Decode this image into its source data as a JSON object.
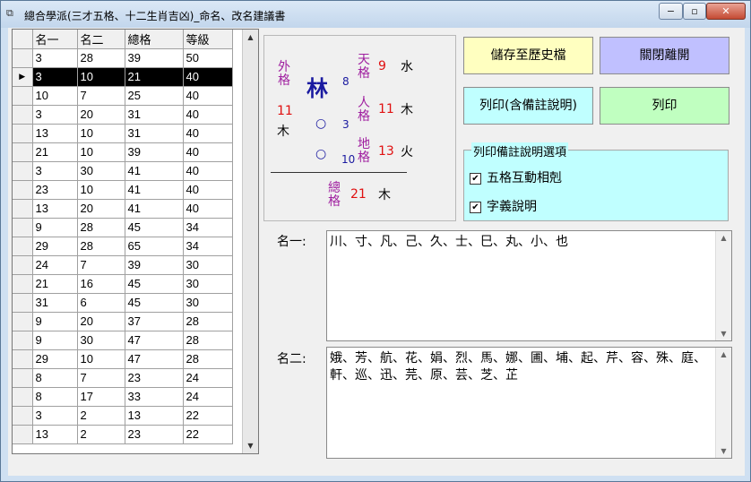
{
  "window": {
    "title": "總合學派(三才五格、十二生肖吉凶)_命名、改名建議書",
    "minimize": "−",
    "restore": "▫",
    "close": "✕"
  },
  "grid": {
    "columns": [
      "名一",
      "名二",
      "總格",
      "等級"
    ],
    "rows": [
      [
        "3",
        "28",
        "39",
        "50"
      ],
      [
        "3",
        "10",
        "21",
        "40"
      ],
      [
        "10",
        "7",
        "25",
        "40"
      ],
      [
        "3",
        "20",
        "31",
        "40"
      ],
      [
        "13",
        "10",
        "31",
        "40"
      ],
      [
        "21",
        "10",
        "39",
        "40"
      ],
      [
        "3",
        "30",
        "41",
        "40"
      ],
      [
        "23",
        "10",
        "41",
        "40"
      ],
      [
        "13",
        "20",
        "41",
        "40"
      ],
      [
        "9",
        "28",
        "45",
        "34"
      ],
      [
        "29",
        "28",
        "65",
        "34"
      ],
      [
        "24",
        "7",
        "39",
        "30"
      ],
      [
        "21",
        "16",
        "45",
        "30"
      ],
      [
        "31",
        "6",
        "45",
        "30"
      ],
      [
        "9",
        "20",
        "37",
        "28"
      ],
      [
        "9",
        "30",
        "47",
        "28"
      ],
      [
        "29",
        "10",
        "47",
        "28"
      ],
      [
        "8",
        "7",
        "23",
        "24"
      ],
      [
        "8",
        "17",
        "33",
        "24"
      ],
      [
        "3",
        "2",
        "13",
        "22"
      ],
      [
        "13",
        "2",
        "23",
        "22"
      ]
    ],
    "selected_row_marker": "▶"
  },
  "figure": {
    "surname": "林",
    "surname_strokes": "8",
    "name1_strokes": "3",
    "name2_strokes": "10",
    "placeholder_glyph": "○",
    "outer_label": "外格",
    "outer_value": "11",
    "outer_element": "木",
    "heaven_label": "天格",
    "heaven_value": "9",
    "heaven_element": "水",
    "person_label": "人格",
    "person_value": "11",
    "person_element": "木",
    "earth_label": "地格",
    "earth_value": "13",
    "earth_element": "火",
    "total_label": "總格",
    "total_value": "21",
    "total_element": "木"
  },
  "buttons": {
    "save_history": "儲存至歷史檔",
    "close_leave": "關閉離開",
    "print_with_notes": "列印(含備註說明)",
    "print": "列印"
  },
  "print_options": {
    "title": "列印備註說明選項",
    "option1": "五格互動相剋",
    "option2": "字義說明",
    "checkmark": "✔"
  },
  "name1": {
    "label": "名一:",
    "chars": "川、寸、凡、己、久、士、巳、丸、小、也"
  },
  "name2": {
    "label": "名二:",
    "chars": "娥、芳、航、花、娟、烈、馬、娜、圃、埔、起、芹、容、殊、庭、軒、巡、迅、芫、原、芸、芝、芷"
  },
  "colors": {
    "btn_yellow": "#ffffc0",
    "btn_purple": "#c0c0ff",
    "btn_cyan": "#c0ffff",
    "btn_green": "#c0ffc0",
    "label_purple": "#a020a0",
    "value_red": "#e01010"
  }
}
